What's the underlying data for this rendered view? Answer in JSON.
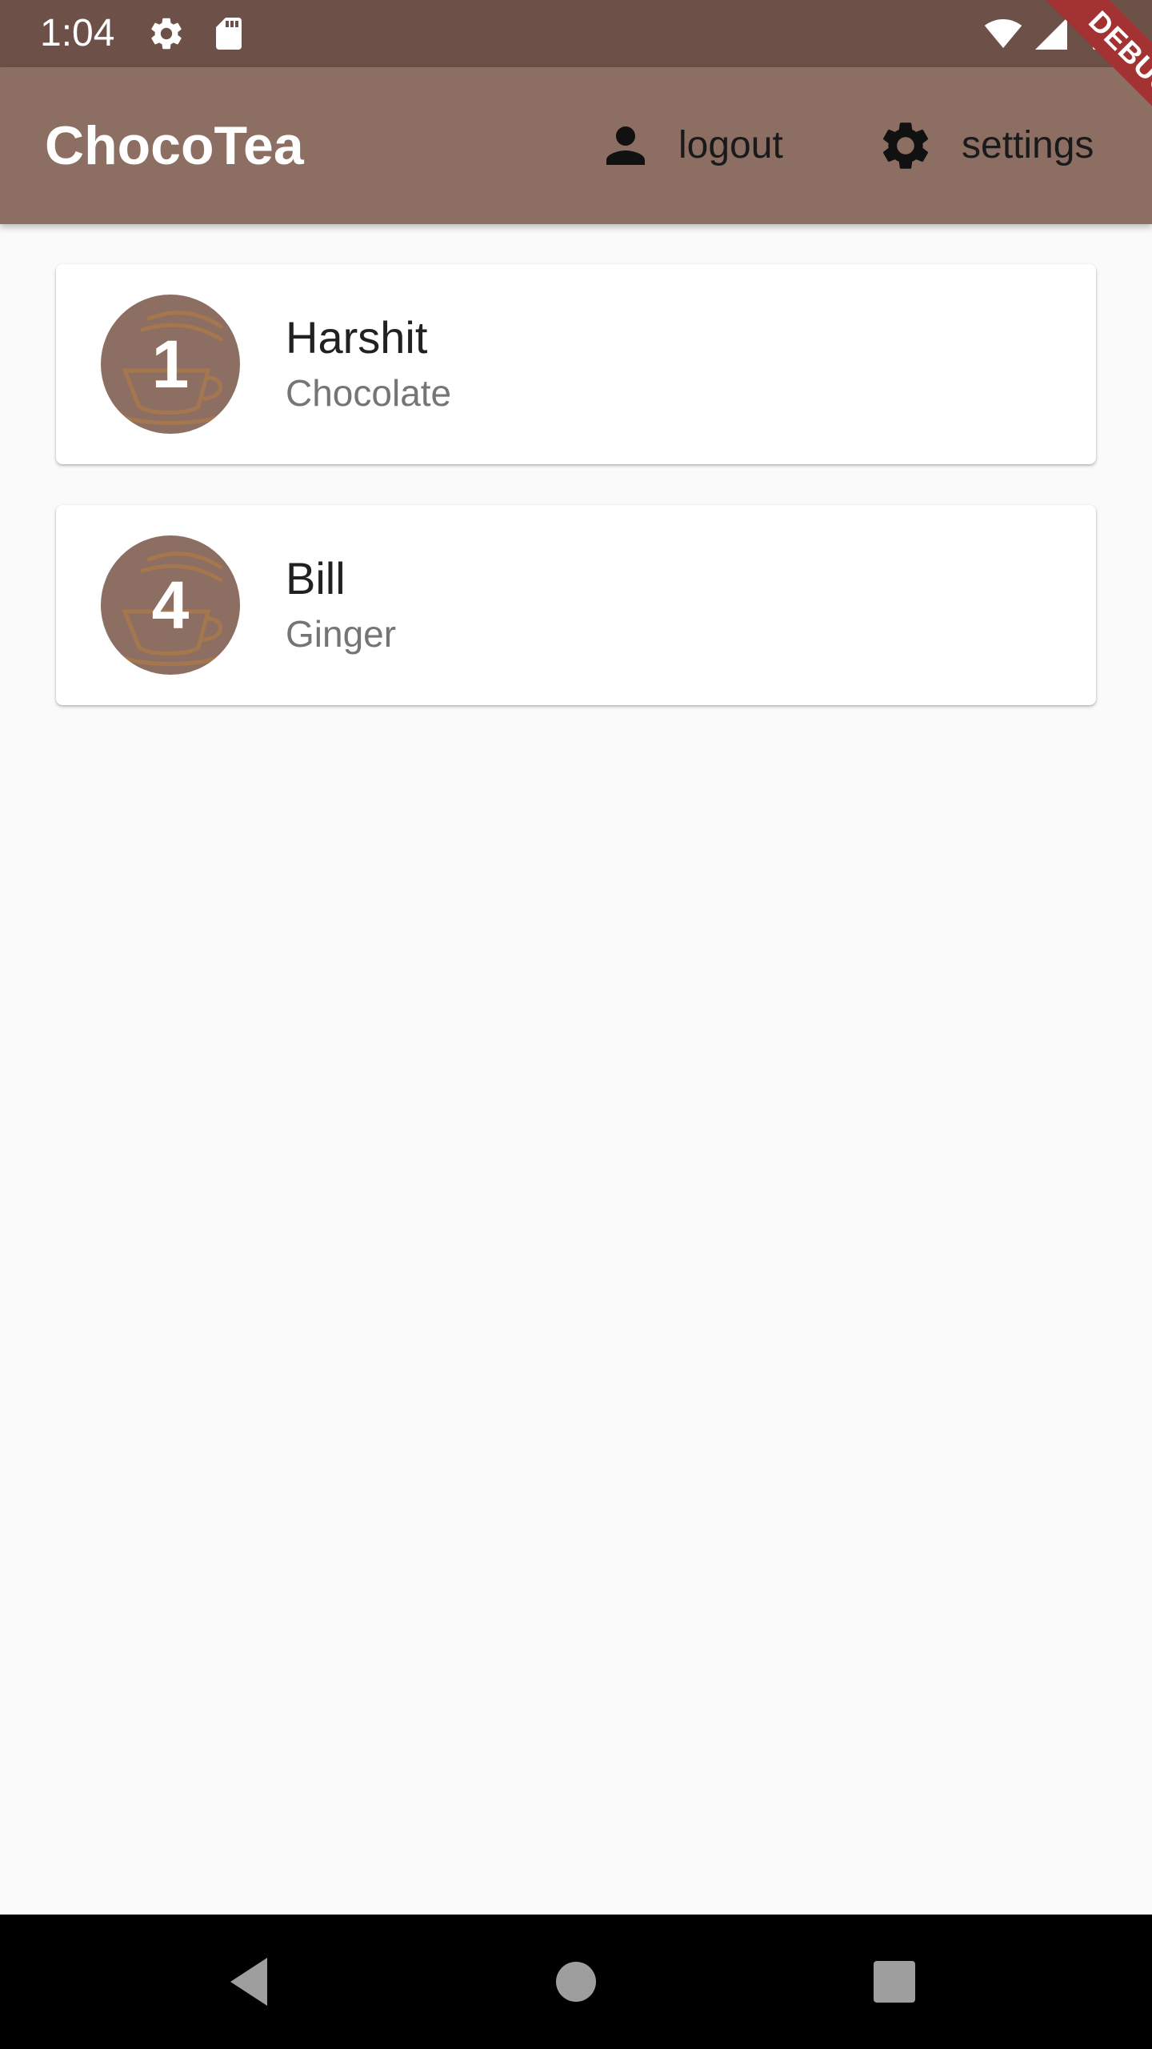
{
  "status_bar": {
    "time": "1:04",
    "left_icons": [
      "gear-icon",
      "sd-card-icon"
    ],
    "right_icons": [
      "wifi-icon",
      "cell-signal-icon",
      "battery-icon"
    ]
  },
  "app_bar": {
    "title": "ChocoTea",
    "background_color": "#8d6e63",
    "actions": [
      {
        "label": "logout",
        "icon": "person-icon"
      },
      {
        "label": "settings",
        "icon": "gear-icon"
      }
    ]
  },
  "debug_banner": {
    "label": "DEBUG",
    "color": "#a33333"
  },
  "orders": [
    {
      "count": "1",
      "name": "Harshit",
      "flavor": "Chocolate"
    },
    {
      "count": "4",
      "name": "Bill",
      "flavor": "Ginger"
    }
  ],
  "nav_bar": {
    "buttons": [
      "back-icon",
      "home-icon",
      "recents-icon"
    ]
  },
  "colors": {
    "status_bar": "#6d5048",
    "accent_brown": "#8d6e63",
    "background": "#fafafa"
  }
}
